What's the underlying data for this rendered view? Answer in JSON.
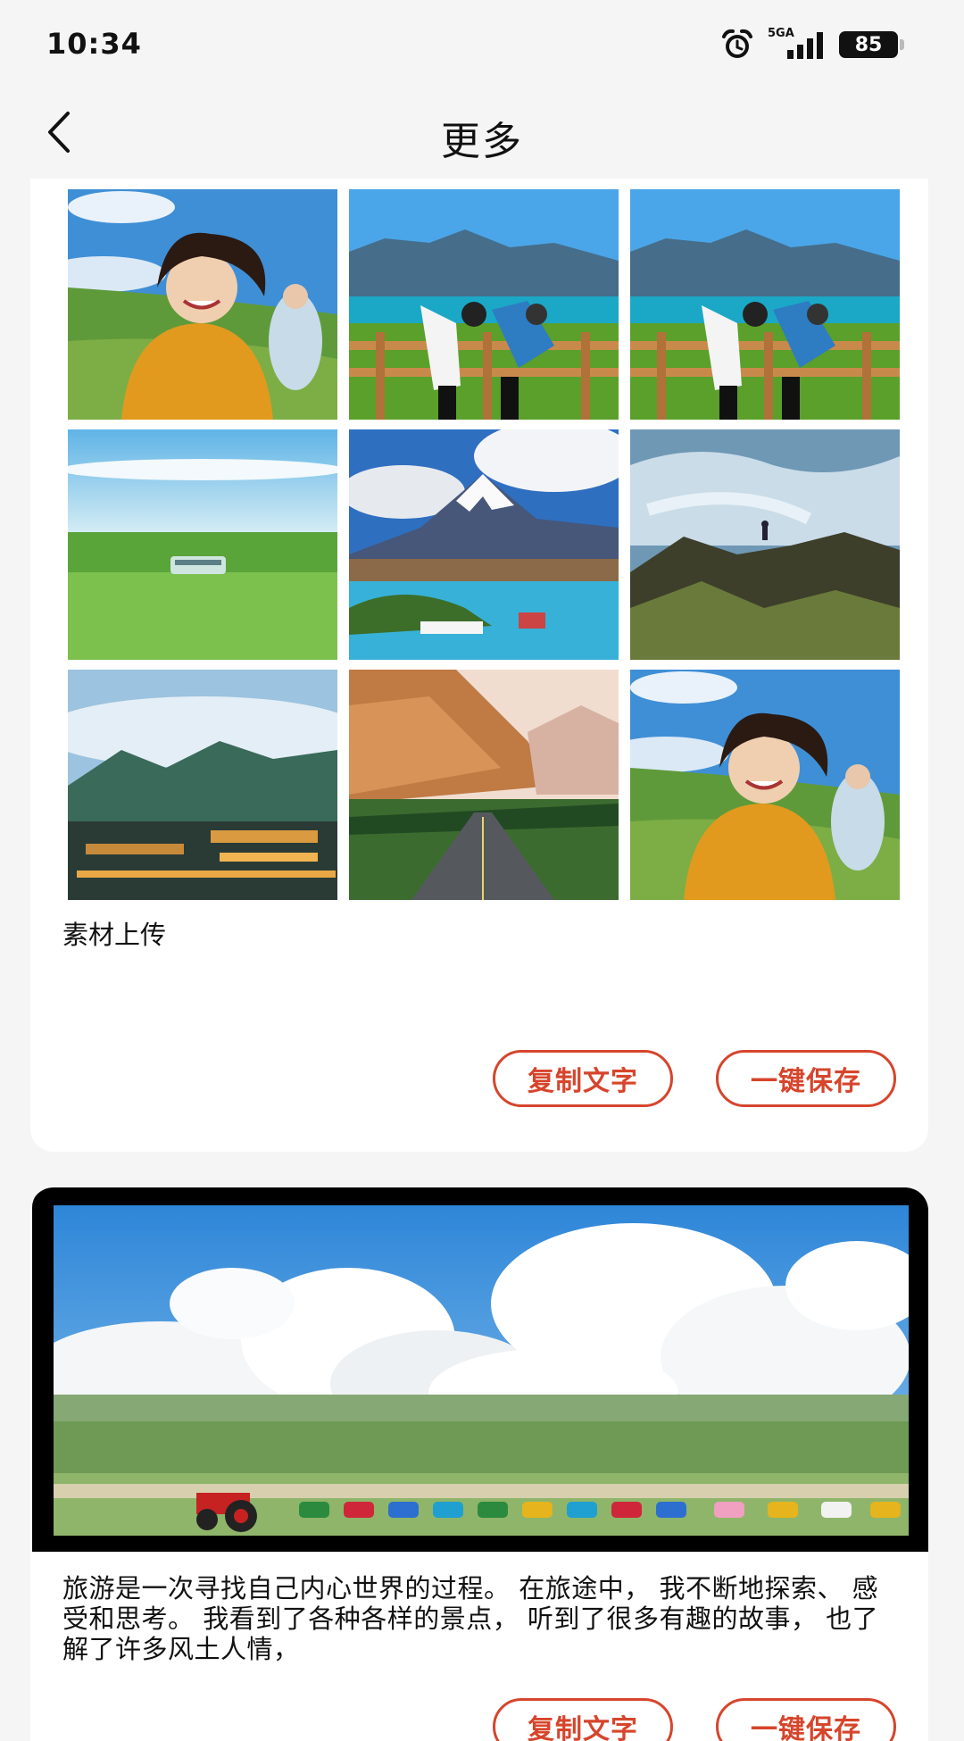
{
  "status_bar": {
    "time": "10:34",
    "network": "5GA",
    "battery": "85"
  },
  "header": {
    "title": "更多"
  },
  "posts": [
    {
      "caption": "素材上传",
      "copy_label": "复制文字",
      "save_label": "一键保存"
    },
    {
      "caption": "旅游是一次寻找自己内心世界的过程。 在旅途中， 我不断地探索、 感受和思考。 我看到了各种各样的景点， 听到了很多有趣的故事， 也了解了许多风土人情，",
      "copy_label": "复制文字",
      "save_label": "一键保存"
    }
  ],
  "icons": {
    "back": "chevron-left-icon",
    "alarm": "alarm-clock-icon",
    "signal": "signal-bars-icon"
  },
  "colors": {
    "accent": "#d6452c",
    "page_background": "#f5f5f5",
    "card_background": "#ffffff"
  }
}
